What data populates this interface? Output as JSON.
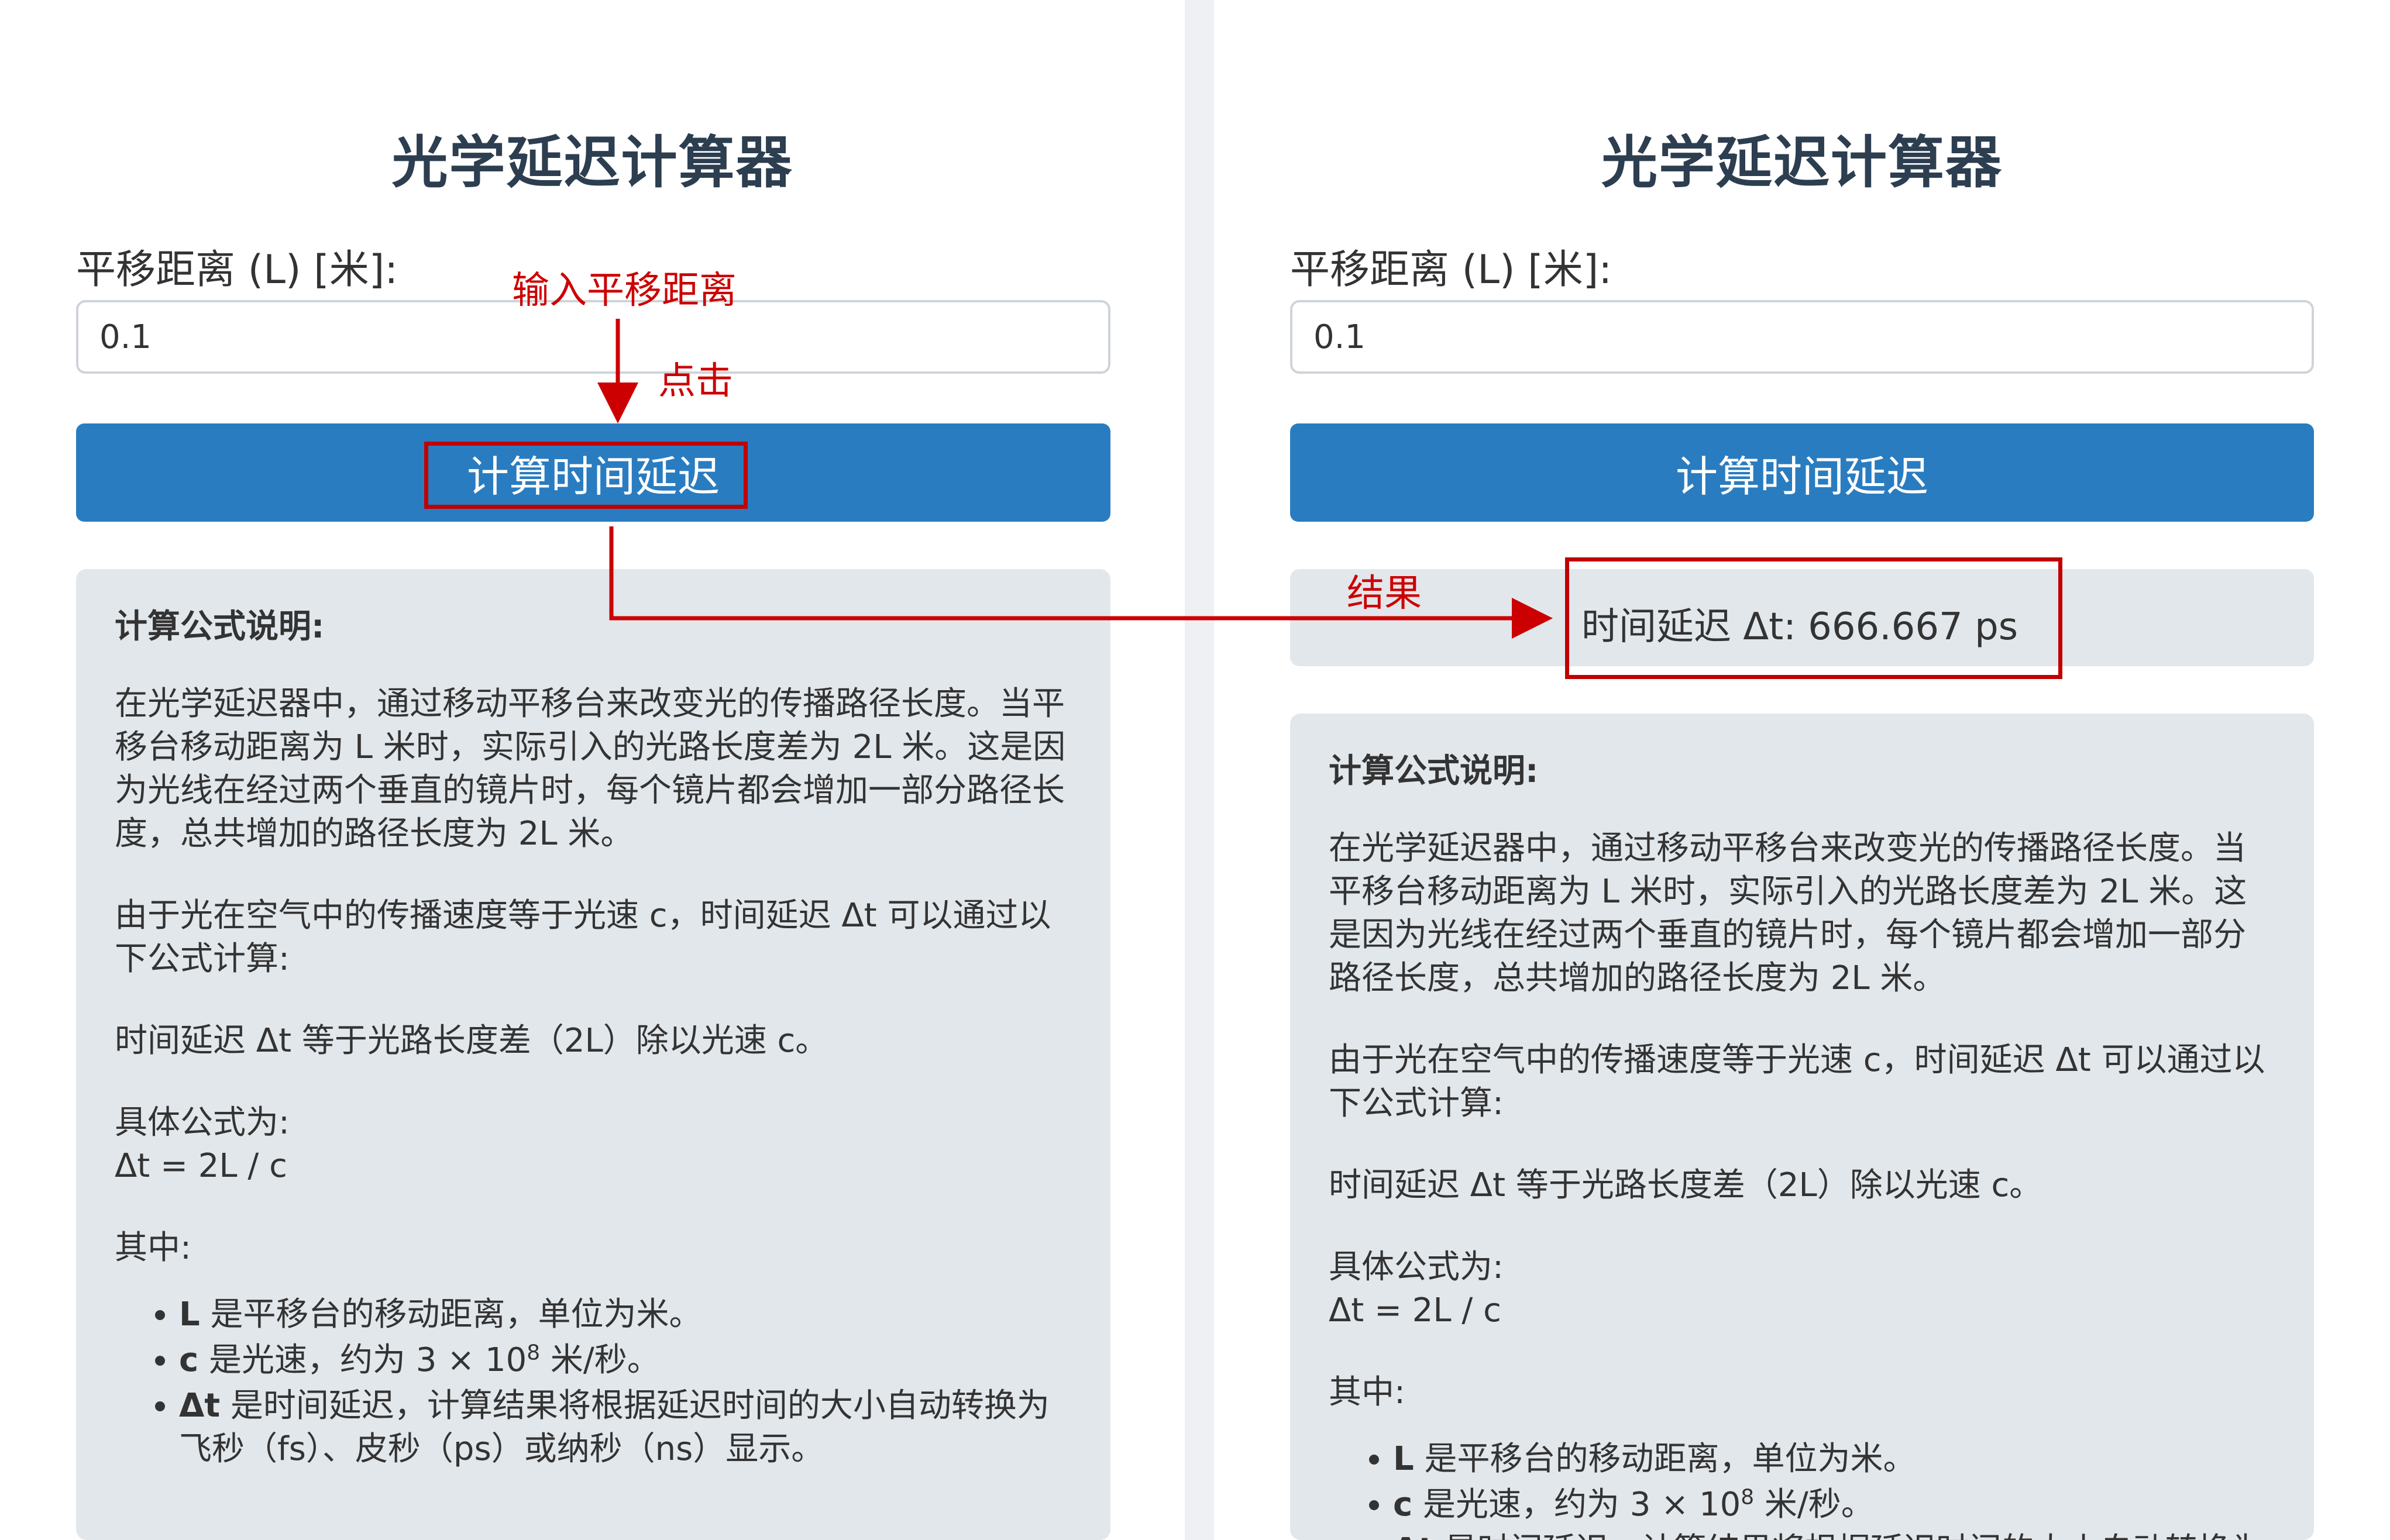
{
  "calculator": {
    "title": "光学延迟计算器",
    "input_label": "平移距离 (L) [米]:",
    "input_value": "0.1",
    "button_label": "计算时间延迟"
  },
  "result": {
    "text": "时间延迟 Δt: 666.667 ps"
  },
  "explanation": {
    "heading": "计算公式说明:",
    "para1": "在光学延迟器中，通过移动平移台来改变光的传播路径长度。当平移台移动距离为 L 米时，实际引入的光路长度差为 2L 米。这是因为光线在经过两个垂直的镜片时，每个镜片都会增加一部分路径长度，总共增加的路径长度为 2L 米。",
    "para2": "由于光在空气中的传播速度等于光速 c，时间延迟 Δt 可以通过以下公式计算:",
    "para3": "时间延迟 Δt 等于光路长度差（2L）除以光速 c。",
    "formula_intro": "具体公式为:",
    "formula": "Δt = 2L / c",
    "where": "其中:",
    "items": [
      {
        "term": "L",
        "desc": " 是平移台的移动距离，单位为米。"
      },
      {
        "term": "c",
        "desc": " 是光速，约为 3 × 10",
        "sup": "8",
        "tail": " 米/秒。"
      },
      {
        "term": "Δt",
        "desc": " 是时间延迟，计算结果将根据延迟时间的大小自动转换为飞秒（fs）、皮秒（ps）或纳秒（ns）显示。"
      }
    ]
  },
  "annotations": {
    "input_note": "输入平移距离",
    "click_note": "点击",
    "result_note": "结果",
    "color": "#cc0000"
  },
  "colors": {
    "button": "#2a7cc0",
    "panel_bg": "#e2e7eb",
    "title": "#2c3e50"
  }
}
